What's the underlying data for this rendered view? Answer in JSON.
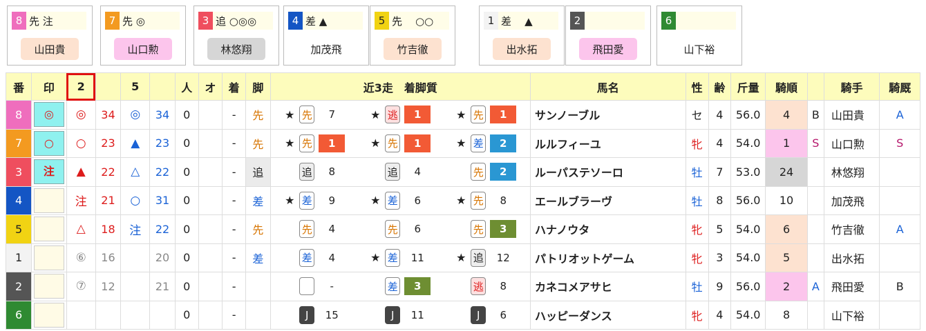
{
  "colors": {
    "red": "#dd1c1c",
    "blue": "#1a62d6",
    "orange": "#d77400",
    "boxRed": "#f25a35",
    "boxBlue": "#2a97d3",
    "boxGreen": "#6e8e32",
    "boxBlack": "#444444",
    "pink": "#fcc5ec",
    "peach": "#fde2d0",
    "grey": "#d6d6d6",
    "cyan": "#8ff1ef"
  },
  "cards": [
    {
      "num": "8",
      "numColor": "#ef6ebd",
      "numText": "#fff",
      "mark": "先 注",
      "jockey": "山田貴",
      "jbg": "#fde2d0"
    },
    {
      "num": "7",
      "numColor": "#f39a20",
      "numText": "#fff",
      "mark": "先 ◎",
      "jockey": "山口勲",
      "jbg": "#fcc5ec"
    },
    {
      "num": "3",
      "numColor": "#ef4e5e",
      "numText": "#fff",
      "mark": "追 ○◎◎",
      "jockey": "林悠翔",
      "jbg": "#d6d6d6"
    },
    {
      "num": "4",
      "numColor": "#1455c4",
      "numText": "#fff",
      "mark": "差 ▲",
      "jockey": "加茂飛",
      "jbg": "#fff"
    },
    {
      "num": "5",
      "numColor": "#f1d313",
      "numText": "#222",
      "mark": "先    ○○",
      "jockey": "竹吉徹",
      "jbg": "#fde2d0"
    },
    {
      "num": "1",
      "numColor": "#f3f3f3",
      "numText": "#222",
      "mark": "差    ▲",
      "jockey": "出水拓",
      "jbg": "#fde2d0"
    },
    {
      "num": "2",
      "numColor": "#555",
      "numText": "#fff",
      "mark": "",
      "jockey": "飛田愛",
      "jbg": "#fcc5ec"
    },
    {
      "num": "6",
      "numColor": "#2f8a32",
      "numText": "#fff",
      "mark": "",
      "jockey": "山下裕",
      "jbg": "#fff"
    }
  ],
  "headers": {
    "ban": "番",
    "shirushi": "印",
    "k2": "2",
    "k5": "5",
    "hito": "人",
    "o": "オ",
    "chaku": "着",
    "kyaku": "脚",
    "recent": "近3走　着脚質",
    "name": "馬名",
    "sex": "性",
    "age": "齢",
    "weight": "斤量",
    "kijun": "騎順",
    "jockey": "騎手",
    "kiu": "騎厩"
  },
  "rows": [
    {
      "ban": "8",
      "banColor": "#ef6ebd",
      "banText": "#fff",
      "mark": "◎",
      "markOn": true,
      "m2": "◎",
      "m2c": "#dd1c1c",
      "v2": "34",
      "v2c": "#dd1c1c",
      "m5": "◎",
      "m5c": "#1a62d6",
      "v5": "34",
      "v5c": "#1a62d6",
      "hito": "0",
      "o": "",
      "chaku": "-",
      "kyaku": "先",
      "kyakuC": "#d77400",
      "kyakuBg": "",
      "recent": [
        {
          "star": "★",
          "style": "先",
          "sc": "#d77400",
          "sbg": "#fff",
          "pos": "7",
          "pbg": "",
          "pc": "#222"
        },
        {
          "star": "★",
          "style": "逃",
          "sc": "#dd1c1c",
          "sbg": "#fde0e0",
          "pos": "1",
          "pbg": "#f25a35",
          "pc": "#fff"
        },
        {
          "star": "★",
          "style": "先",
          "sc": "#d77400",
          "sbg": "#fff",
          "pos": "1",
          "pbg": "#f25a35",
          "pc": "#fff"
        }
      ],
      "name": "サンノーブル",
      "sex": "セ",
      "sexC": "#222",
      "age": "4",
      "weight": "56.0",
      "kijun": "4",
      "kbg": "#fde2d0",
      "kb": "B",
      "kbc": "#222",
      "jockey": "山田貴",
      "kiu": "A",
      "kiuc": "#1a62d6"
    },
    {
      "ban": "7",
      "banColor": "#f39a20",
      "banText": "#fff",
      "mark": "○",
      "markOn": true,
      "m2": "○",
      "m2c": "#dd1c1c",
      "v2": "23",
      "v2c": "#dd1c1c",
      "m5": "▲",
      "m5c": "#1a62d6",
      "v5": "23",
      "v5c": "#1a62d6",
      "hito": "0",
      "o": "",
      "chaku": "-",
      "kyaku": "先",
      "kyakuC": "#d77400",
      "kyakuBg": "",
      "recent": [
        {
          "star": "★",
          "style": "先",
          "sc": "#d77400",
          "sbg": "#fff",
          "pos": "1",
          "pbg": "#f25a35",
          "pc": "#fff"
        },
        {
          "star": "★",
          "style": "先",
          "sc": "#d77400",
          "sbg": "#fff",
          "pos": "1",
          "pbg": "#f25a35",
          "pc": "#fff"
        },
        {
          "star": "★",
          "style": "差",
          "sc": "#1a62d6",
          "sbg": "#fff",
          "pos": "2",
          "pbg": "#2a97d3",
          "pc": "#fff"
        }
      ],
      "name": "ルルフィーユ",
      "sex": "牝",
      "sexC": "#dd1c1c",
      "age": "4",
      "weight": "54.0",
      "kijun": "1",
      "kbg": "#fcc5ec",
      "kb": "S",
      "kbc": "#b5166b",
      "jockey": "山口勲",
      "kiu": "S",
      "kiuc": "#b5166b"
    },
    {
      "ban": "3",
      "banColor": "#ef4e5e",
      "banText": "#fff",
      "mark": "注",
      "markOn": true,
      "m2": "▲",
      "m2c": "#dd1c1c",
      "v2": "22",
      "v2c": "#dd1c1c",
      "m5": "△",
      "m5c": "#1a62d6",
      "v5": "22",
      "v5c": "#1a62d6",
      "hito": "0",
      "o": "",
      "chaku": "-",
      "kyaku": "追",
      "kyakuC": "#222",
      "kyakuBg": "#ebebeb",
      "recent": [
        {
          "star": "",
          "style": "追",
          "sc": "#222",
          "sbg": "#eee",
          "pos": "8",
          "pbg": "",
          "pc": "#222"
        },
        {
          "star": "",
          "style": "追",
          "sc": "#222",
          "sbg": "#eee",
          "pos": "4",
          "pbg": "",
          "pc": "#222"
        },
        {
          "star": "",
          "style": "先",
          "sc": "#d77400",
          "sbg": "#fff",
          "pos": "2",
          "pbg": "#2a97d3",
          "pc": "#fff"
        }
      ],
      "name": "ルーパステソーロ",
      "sex": "牡",
      "sexC": "#1a62d6",
      "age": "7",
      "weight": "53.0",
      "kijun": "24",
      "kbg": "#d6d6d6",
      "kb": "",
      "kbc": "#222",
      "jockey": "林悠翔",
      "kiu": "",
      "kiuc": "#222"
    },
    {
      "ban": "4",
      "banColor": "#1455c4",
      "banText": "#fff",
      "mark": "",
      "markOn": false,
      "m2": "注",
      "m2c": "#dd1c1c",
      "v2": "21",
      "v2c": "#dd1c1c",
      "m5": "○",
      "m5c": "#1a62d6",
      "v5": "31",
      "v5c": "#1a62d6",
      "hito": "0",
      "o": "",
      "chaku": "-",
      "kyaku": "差",
      "kyakuC": "#1a62d6",
      "kyakuBg": "",
      "recent": [
        {
          "star": "★",
          "style": "差",
          "sc": "#1a62d6",
          "sbg": "#fff",
          "pos": "9",
          "pbg": "",
          "pc": "#222"
        },
        {
          "star": "★",
          "style": "差",
          "sc": "#1a62d6",
          "sbg": "#fff",
          "pos": "6",
          "pbg": "",
          "pc": "#222"
        },
        {
          "star": "★",
          "style": "先",
          "sc": "#d77400",
          "sbg": "#fff",
          "pos": "8",
          "pbg": "",
          "pc": "#222"
        }
      ],
      "name": "エールブラーヴ",
      "sex": "牡",
      "sexC": "#1a62d6",
      "age": "8",
      "weight": "56.0",
      "kijun": "10",
      "kbg": "",
      "kb": "",
      "kbc": "#222",
      "jockey": "加茂飛",
      "kiu": "",
      "kiuc": "#222"
    },
    {
      "ban": "5",
      "banColor": "#f1d313",
      "banText": "#222",
      "mark": "",
      "markOn": false,
      "m2": "△",
      "m2c": "#dd1c1c",
      "v2": "18",
      "v2c": "#dd1c1c",
      "m5": "注",
      "m5c": "#1a62d6",
      "v5": "22",
      "v5c": "#1a62d6",
      "hito": "0",
      "o": "",
      "chaku": "-",
      "kyaku": "先",
      "kyakuC": "#d77400",
      "kyakuBg": "",
      "recent": [
        {
          "star": "",
          "style": "先",
          "sc": "#d77400",
          "sbg": "#fff",
          "pos": "4",
          "pbg": "",
          "pc": "#222"
        },
        {
          "star": "",
          "style": "先",
          "sc": "#d77400",
          "sbg": "#fff",
          "pos": "6",
          "pbg": "",
          "pc": "#222"
        },
        {
          "star": "",
          "style": "先",
          "sc": "#d77400",
          "sbg": "#fff",
          "pos": "3",
          "pbg": "#6e8e32",
          "pc": "#fff"
        }
      ],
      "name": "ハナノウタ",
      "sex": "牝",
      "sexC": "#dd1c1c",
      "age": "5",
      "weight": "54.0",
      "kijun": "6",
      "kbg": "#fde2d0",
      "kb": "",
      "kbc": "#222",
      "jockey": "竹吉徹",
      "kiu": "A",
      "kiuc": "#1a62d6"
    },
    {
      "ban": "1",
      "banColor": "#f3f3f3",
      "banText": "#222",
      "mark": "",
      "markOn": false,
      "m2": "⑥",
      "m2c": "#888",
      "v2": "16",
      "v2c": "#888",
      "m5": "",
      "m5c": "#888",
      "v5": "20",
      "v5c": "#888",
      "hito": "0",
      "o": "",
      "chaku": "-",
      "kyaku": "差",
      "kyakuC": "#1a62d6",
      "kyakuBg": "",
      "recent": [
        {
          "star": "",
          "style": "差",
          "sc": "#1a62d6",
          "sbg": "#fff",
          "pos": "4",
          "pbg": "",
          "pc": "#222"
        },
        {
          "star": "★",
          "style": "差",
          "sc": "#1a62d6",
          "sbg": "#fff",
          "pos": "11",
          "pbg": "",
          "pc": "#222"
        },
        {
          "star": "★",
          "style": "追",
          "sc": "#222",
          "sbg": "#eee",
          "pos": "12",
          "pbg": "",
          "pc": "#222"
        }
      ],
      "name": "パトリオットゲーム",
      "sex": "牝",
      "sexC": "#dd1c1c",
      "age": "3",
      "weight": "54.0",
      "kijun": "5",
      "kbg": "#fde2d0",
      "kb": "",
      "kbc": "#222",
      "jockey": "出水拓",
      "kiu": "",
      "kiuc": "#222"
    },
    {
      "ban": "2",
      "banColor": "#555",
      "banText": "#fff",
      "mark": "",
      "markOn": false,
      "m2": "⑦",
      "m2c": "#888",
      "v2": "12",
      "v2c": "#888",
      "m5": "",
      "m5c": "#888",
      "v5": "21",
      "v5c": "#888",
      "hito": "0",
      "o": "",
      "chaku": "-",
      "kyaku": "",
      "kyakuC": "#222",
      "kyakuBg": "",
      "recent": [
        {
          "star": "",
          "style": "",
          "sc": "#222",
          "sbg": "#fff",
          "pos": "-",
          "pbg": "",
          "pc": "#222"
        },
        {
          "star": "",
          "style": "差",
          "sc": "#1a62d6",
          "sbg": "#fff",
          "pos": "3",
          "pbg": "#6e8e32",
          "pc": "#fff"
        },
        {
          "star": "",
          "style": "逃",
          "sc": "#dd1c1c",
          "sbg": "#fde0e0",
          "pos": "8",
          "pbg": "",
          "pc": "#222"
        }
      ],
      "name": "カネコメアサヒ",
      "sex": "牡",
      "sexC": "#1a62d6",
      "age": "9",
      "weight": "56.0",
      "kijun": "2",
      "kbg": "#fcc5ec",
      "kb": "A",
      "kbc": "#1a62d6",
      "jockey": "飛田愛",
      "kiu": "B",
      "kiuc": "#222"
    },
    {
      "ban": "6",
      "banColor": "#2f8a32",
      "banText": "#fff",
      "mark": "",
      "markOn": false,
      "m2": "",
      "m2c": "#888",
      "v2": "",
      "v2c": "#888",
      "m5": "",
      "m5c": "#888",
      "v5": "",
      "v5c": "#888",
      "hito": "0",
      "o": "",
      "chaku": "-",
      "kyaku": "",
      "kyakuC": "#222",
      "kyakuBg": "",
      "recent": [
        {
          "star": "",
          "style": "J",
          "sc": "#fff",
          "sbg": "#444",
          "pos": "15",
          "pbg": "",
          "pc": "#222"
        },
        {
          "star": "",
          "style": "J",
          "sc": "#fff",
          "sbg": "#444",
          "pos": "11",
          "pbg": "",
          "pc": "#222"
        },
        {
          "star": "",
          "style": "J",
          "sc": "#fff",
          "sbg": "#444",
          "pos": "6",
          "pbg": "",
          "pc": "#222"
        }
      ],
      "name": "ハッピーダンス",
      "sex": "牝",
      "sexC": "#dd1c1c",
      "age": "4",
      "weight": "54.0",
      "kijun": "8",
      "kbg": "",
      "kb": "",
      "kbc": "#222",
      "jockey": "山下裕",
      "kiu": "",
      "kiuc": "#222"
    }
  ]
}
